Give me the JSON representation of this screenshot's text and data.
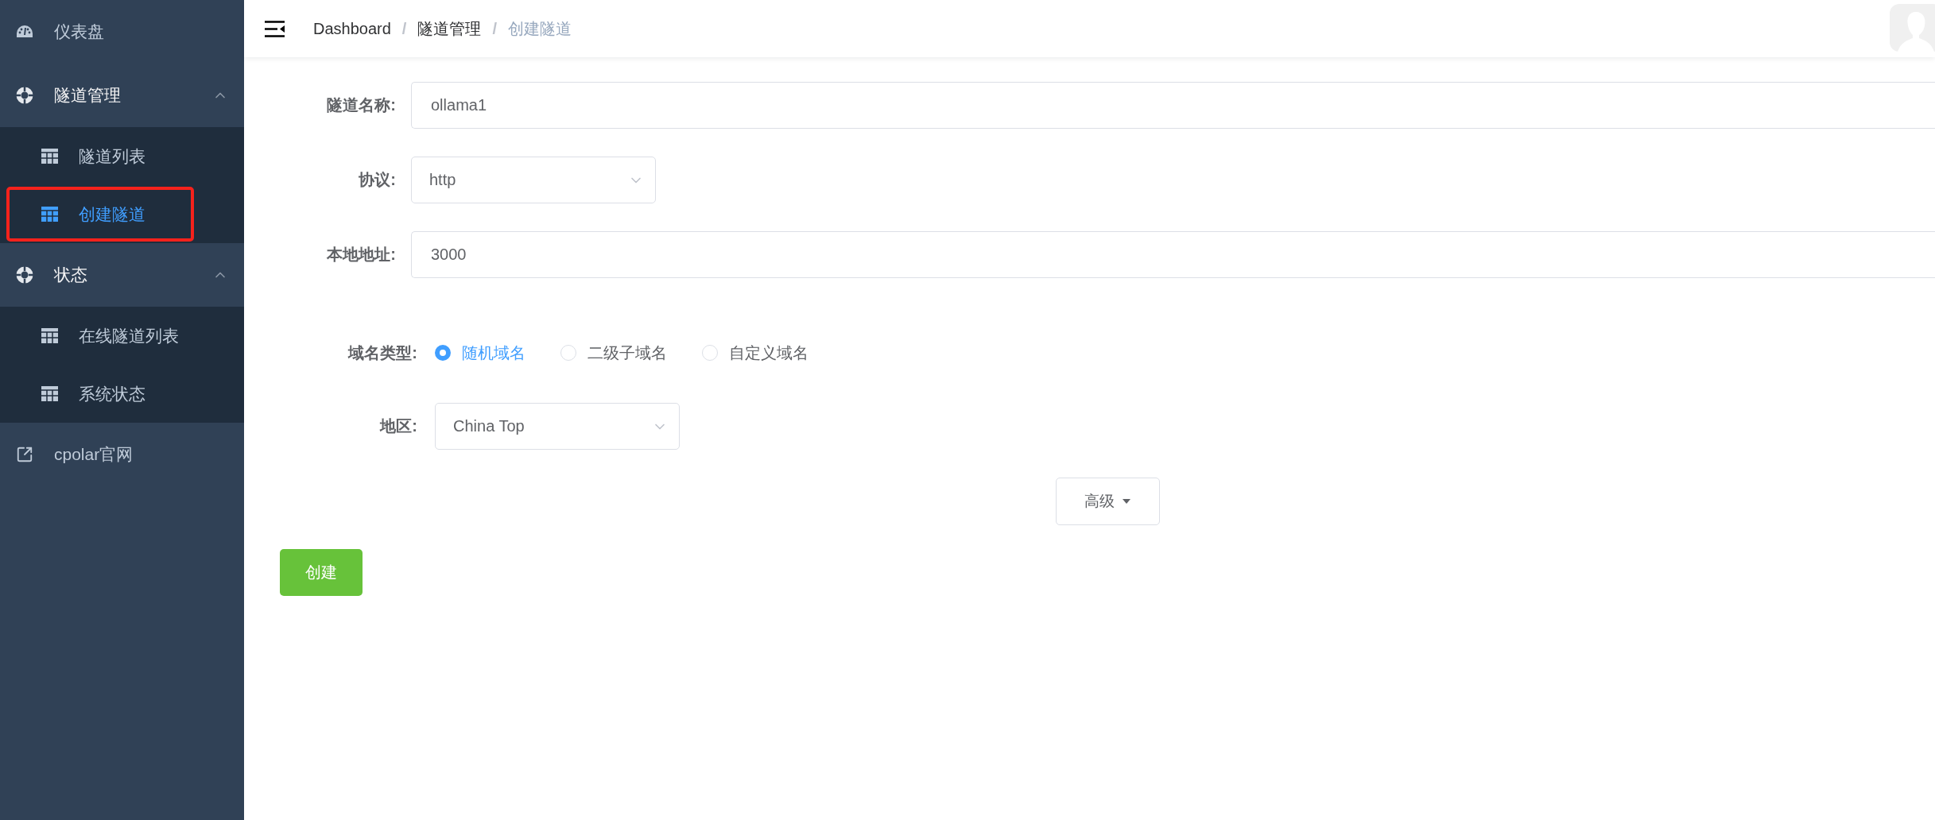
{
  "sidebar": {
    "items": [
      {
        "kind": "item",
        "label": "仪表盘"
      },
      {
        "kind": "group",
        "label": "隧道管理",
        "expanded": true,
        "children": [
          {
            "label": "隧道列表",
            "selected": false,
            "highlighted": false
          },
          {
            "label": "创建隧道",
            "selected": true,
            "highlighted": true
          }
        ]
      },
      {
        "kind": "group",
        "label": "状态",
        "expanded": true,
        "children": [
          {
            "label": "在线隧道列表",
            "selected": false,
            "highlighted": false
          },
          {
            "label": "系统状态",
            "selected": false,
            "highlighted": false
          }
        ]
      },
      {
        "kind": "link",
        "label": "cpolar官网"
      }
    ]
  },
  "breadcrumb_separator": "/",
  "breadcrumb": [
    {
      "label": "Dashboard",
      "selected": false
    },
    {
      "label": "隧道管理",
      "selected": false
    },
    {
      "label": "创建隧道",
      "selected": true
    }
  ],
  "form": {
    "fields": [
      {
        "kind": "input",
        "label": "隧道名称:",
        "value": "ollama1"
      },
      {
        "kind": "select",
        "label": "协议:",
        "value": "http"
      },
      {
        "kind": "input",
        "label": "本地地址:",
        "value": "3000"
      }
    ],
    "domain_type": {
      "label": "域名类型:",
      "options": [
        {
          "label": "随机域名",
          "selected": true
        },
        {
          "label": "二级子域名",
          "selected": false
        },
        {
          "label": "自定义域名",
          "selected": false
        }
      ]
    },
    "region": {
      "label": "地区:",
      "value": "China Top"
    },
    "advanced_button": "高级",
    "submit_button": "创建"
  }
}
